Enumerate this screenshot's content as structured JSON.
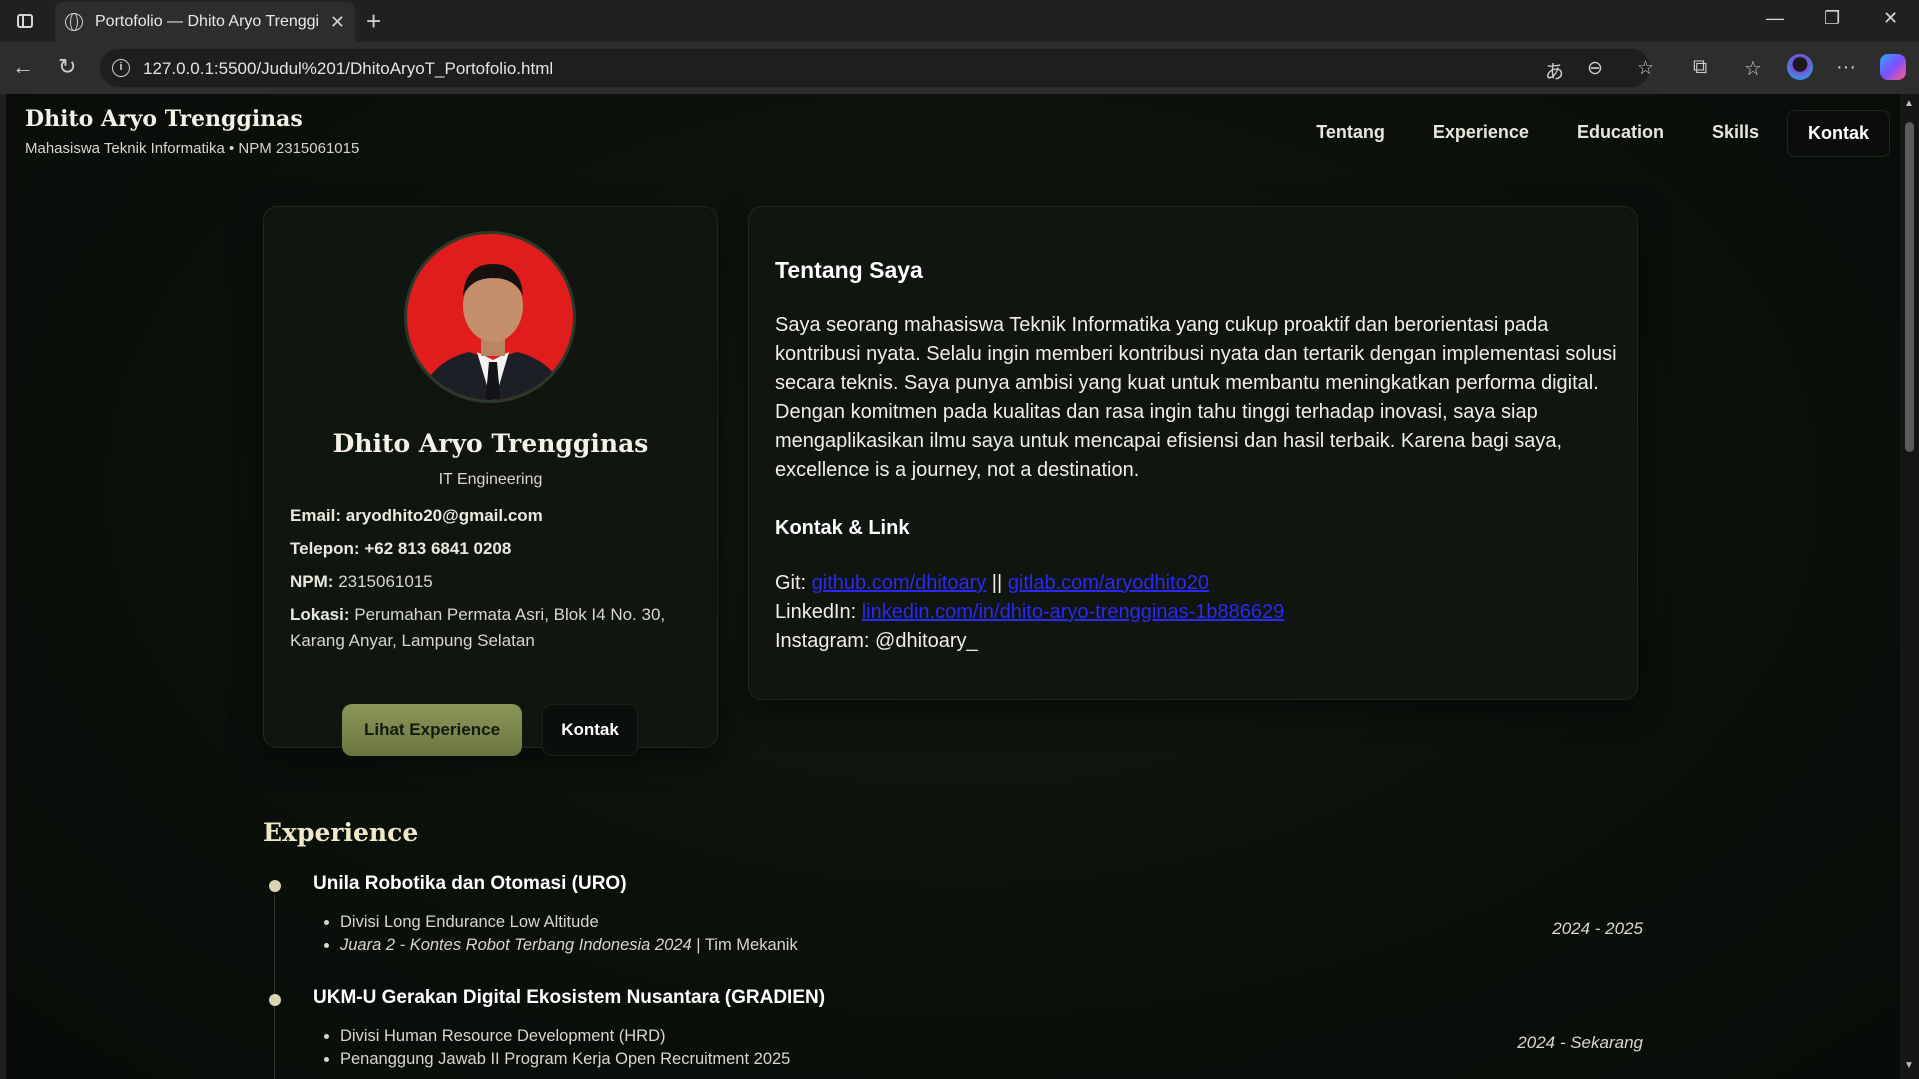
{
  "browser": {
    "tab_title": "Portofolio — Dhito Aryo Trengginas",
    "url": "127.0.0.1:5500/Judul%201/DhitoAryoT_Portofolio.html"
  },
  "header": {
    "name": "Dhito Aryo Trengginas",
    "subtitle": "Mahasiswa Teknik Informatika • NPM 2315061015",
    "nav": [
      "Tentang",
      "Experience",
      "Education",
      "Skills",
      "Kontak"
    ]
  },
  "profile": {
    "name": "Dhito Aryo Trengginas",
    "role": "IT Engineering",
    "email_label": "Email:",
    "email": "aryodhito20@gmail.com",
    "phone_label": "Telepon:",
    "phone": "+62 813 6841 0208",
    "npm_label": "NPM:",
    "npm": "2315061015",
    "location_label": "Lokasi:",
    "location": "Perumahan Permata Asri, Blok I4 No. 30, Karang Anyar, Lampung Selatan",
    "btn_experience": "Lihat Experience",
    "btn_contact": "Kontak"
  },
  "about": {
    "title": "Tentang Saya",
    "text": "Saya seorang mahasiswa Teknik Informatika yang cukup proaktif dan berorientasi pada kontribusi nyata. Selalu ingin memberi kontribusi nyata dan tertarik dengan implementasi solusi secara teknis. Saya punya ambisi yang kuat untuk membantu meningkatkan performa digital. Dengan komitmen pada kualitas dan rasa ingin tahu tinggi terhadap inovasi, saya siap mengaplikasikan ilmu saya untuk mencapai efisiensi dan hasil terbaik. Karena bagi saya, excellence is a journey, not a destination.",
    "links_title": "Kontak & Link",
    "git_label": "Git:",
    "git_1": "github.com/dhitoary",
    "git_sep": "||",
    "git_2": "gitlab.com/aryodhito20",
    "linkedin_label": "LinkedIn:",
    "linkedin": "linkedin.com/in/dhito-aryo-trengginas-1b886629",
    "instagram_label": "Instagram:",
    "instagram": "@dhitoary_"
  },
  "experience": {
    "title": "Experience",
    "items": [
      {
        "org": "Unila Robotika dan Otomasi (URO)",
        "bullets": [
          "Divisi Long Endurance Low Altitude",
          "Juara 2 - Kontes Robot Terbang Indonesia 2024",
          "Tim Mekanik"
        ],
        "period": "2024 - 2025"
      },
      {
        "org": "UKM-U Gerakan Digital Ekosistem Nusantara (GRADIEN)",
        "bullets": [
          "Divisi Human Resource Development (HRD)",
          "Penanggung Jawab II Program Kerja Open Recruitment 2025"
        ],
        "period": "2024 - Sekarang"
      }
    ]
  },
  "colors": {
    "background": "#0b100b",
    "accent": "#7a8649",
    "link": "#2a2af0",
    "avatar_bg": "#e11c1c"
  }
}
